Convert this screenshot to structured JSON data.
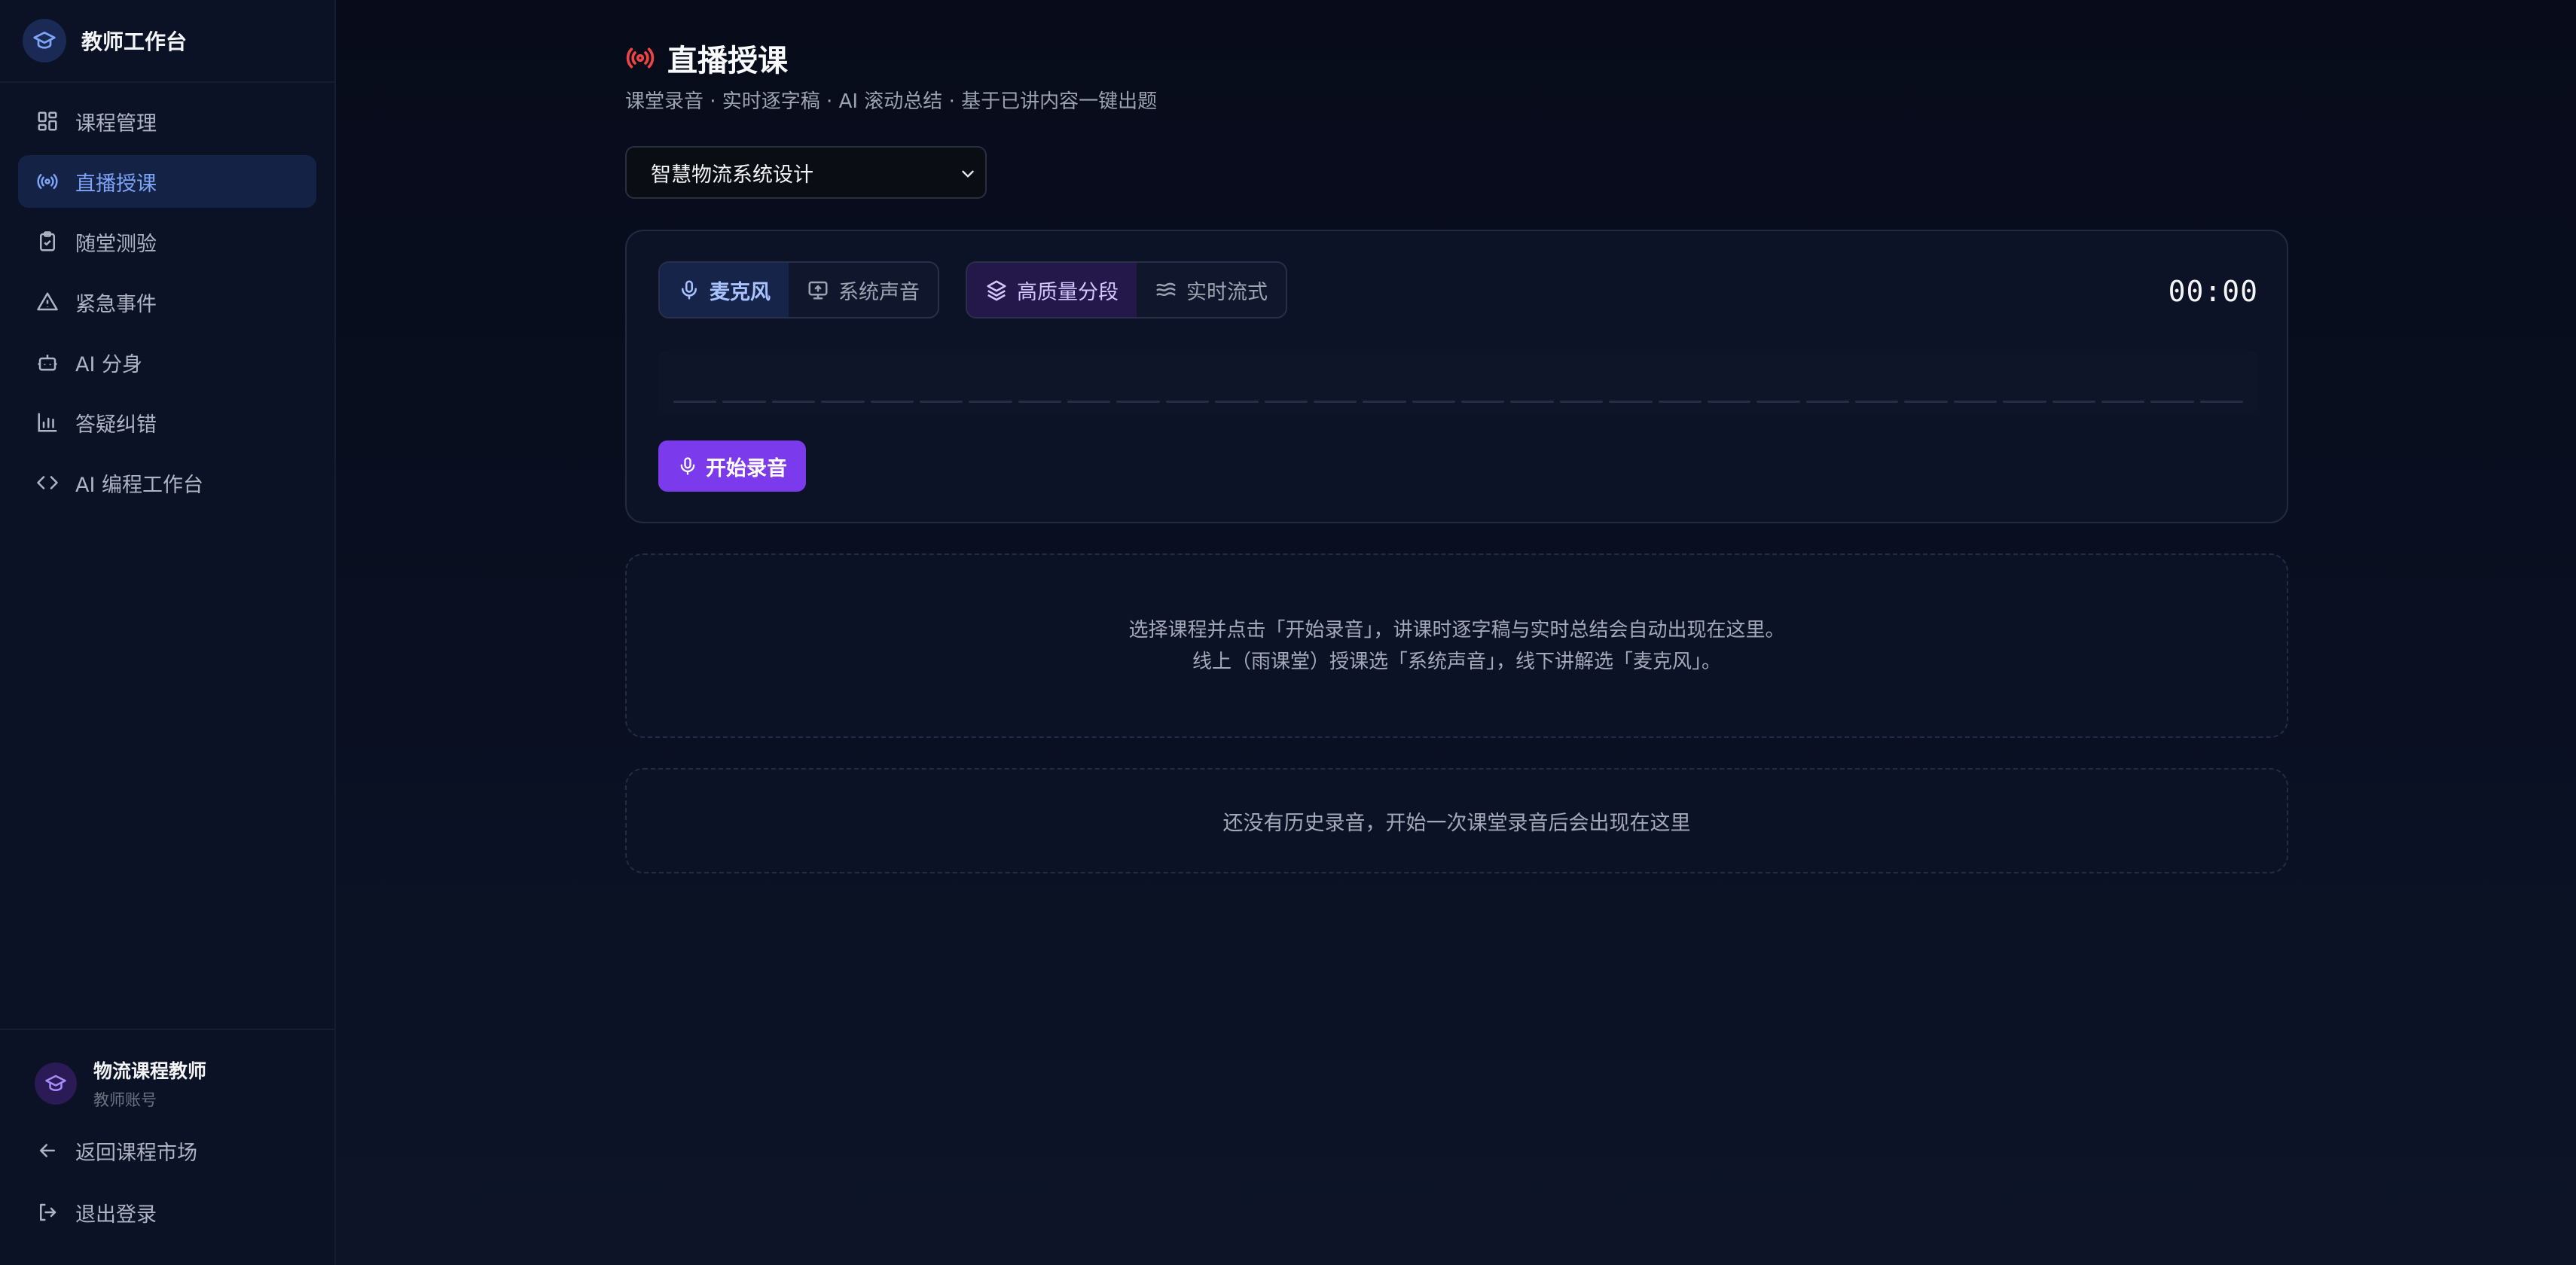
{
  "app": {
    "title": "教师工作台"
  },
  "sidebar": {
    "items": [
      {
        "label": "课程管理",
        "icon": "grid-icon",
        "active": false
      },
      {
        "label": "直播授课",
        "icon": "broadcast-icon",
        "active": true
      },
      {
        "label": "随堂测验",
        "icon": "clipboard-check-icon",
        "active": false
      },
      {
        "label": "紧急事件",
        "icon": "warning-triangle-icon",
        "active": false
      },
      {
        "label": "AI 分身",
        "icon": "robot-icon",
        "active": false
      },
      {
        "label": "答疑纠错",
        "icon": "bar-chart-icon",
        "active": false
      },
      {
        "label": "AI 编程工作台",
        "icon": "code-icon",
        "active": false
      }
    ],
    "user": {
      "name": "物流课程教师",
      "role": "教师账号"
    },
    "back_label": "返回课程市场",
    "logout_label": "退出登录"
  },
  "main": {
    "title": "直播授课",
    "subtitle": "课堂录音 · 实时逐字稿 · AI 滚动总结 · 基于已讲内容一键出题",
    "course_select": {
      "selected": "智慧物流系统设计"
    },
    "recorder": {
      "source_options": [
        "麦克风",
        "系统声音"
      ],
      "source_selected": "麦克风",
      "mode_options": [
        "高质量分段",
        "实时流式"
      ],
      "mode_selected": "高质量分段",
      "timer": "00:00",
      "start_label": "开始录音"
    },
    "hint": {
      "line1": "选择课程并点击「开始录音」，讲课时逐字稿与实时总结会自动出现在这里。",
      "line2": "线上（雨课堂）授课选「系统声音」，线下讲解选「麦克风」。"
    },
    "history": {
      "empty_text": "还没有历史录音，开始一次课堂录音后会出现在这里"
    }
  },
  "colors": {
    "accent_purple": "#7c3aed",
    "active_blue": "#7ea5f8",
    "live_red": "#ef4444"
  }
}
